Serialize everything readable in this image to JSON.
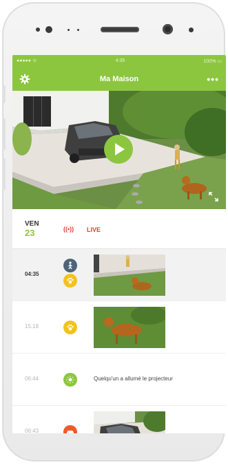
{
  "status_bar": {
    "carrier": "●●●●● ᯤ",
    "time": "4:35",
    "battery": "100% ▭"
  },
  "app_bar": {
    "title": "Ma Maison",
    "settings_icon": "gear-icon",
    "more_label": "•••"
  },
  "colors": {
    "brand": "#8cc63f",
    "live": "#e53935",
    "person": "#4f6479",
    "animal": "#f4c21b",
    "light": "#8cc63f",
    "vehicle": "#ef5a28"
  },
  "date_header": {
    "day": "VEN",
    "date": "23",
    "live_icon": "((•))",
    "live_label": "LIVE"
  },
  "events": [
    {
      "time": "04:35",
      "icons": [
        "person-icon",
        "animal-icon"
      ],
      "type": "thumbnail"
    },
    {
      "time": "15:18",
      "icons": [
        "animal-icon"
      ],
      "type": "thumbnail"
    },
    {
      "time": "06:44",
      "icons": [
        "light-icon"
      ],
      "type": "text",
      "message": "Quelqu'un a allumé le projecteur"
    },
    {
      "time": "06:43",
      "icons": [
        "vehicle-icon"
      ],
      "type": "thumbnail"
    }
  ]
}
